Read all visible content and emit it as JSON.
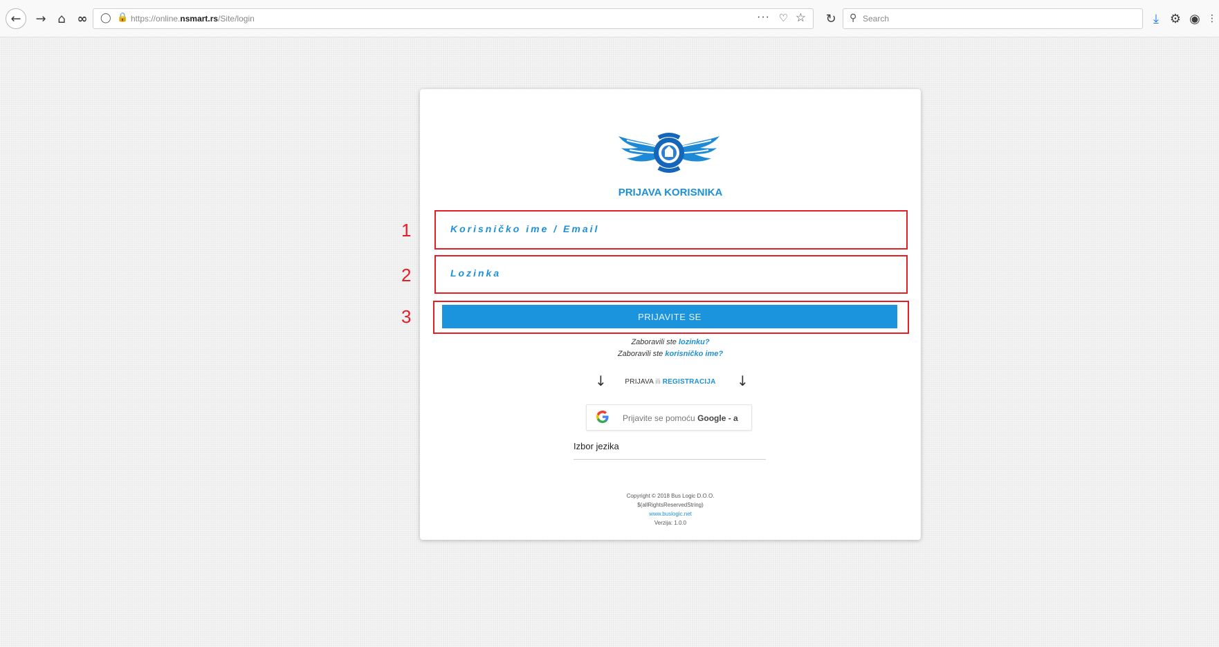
{
  "browser": {
    "url_prefix": "https://online.",
    "url_host": "nsmart.rs",
    "url_path": "/Site/login",
    "url_more": "···",
    "search_placeholder": "Search",
    "icons": [
      "back-arrow-icon",
      "forward-arrow-icon",
      "home-icon",
      "infinity-icon",
      "shield-icon",
      "lock-icon",
      "pocket-icon",
      "star-icon",
      "reload-icon",
      "search-icon",
      "download-icon",
      "gear-icon",
      "account-icon",
      "menu-icon"
    ]
  },
  "login": {
    "title": "PRIJAVA KORISNIKA",
    "username_placeholder": "Korisničko ime / Email",
    "password_placeholder": "Lozinka",
    "submit_label": "PRIJAVITE SE",
    "forgot_prefix": "Zaboravili ste",
    "forgot_password_link": "lozinku?",
    "forgot_username_link": "korisničko ime?",
    "mode_left": "PRIJAVA",
    "mode_ili": "ili",
    "mode_link": "REGISTRACIJA",
    "arrow": "↓",
    "google_prefix": "Prijavite se pomoću",
    "google_bold": "Google - a",
    "language_label": "Izbor jezika"
  },
  "footer": {
    "copyright": "Copyright © 2018 Bus Logic D.O.O.",
    "rights": "$(allRightsReservedString)",
    "website": "www.buslogic.net",
    "version": "Verzija: 1.0.0"
  },
  "annotations": [
    "1",
    "2",
    "3"
  ],
  "colors": {
    "accent": "#1e90d6",
    "button": "#1b93dd",
    "annotation": "#e41e26"
  }
}
